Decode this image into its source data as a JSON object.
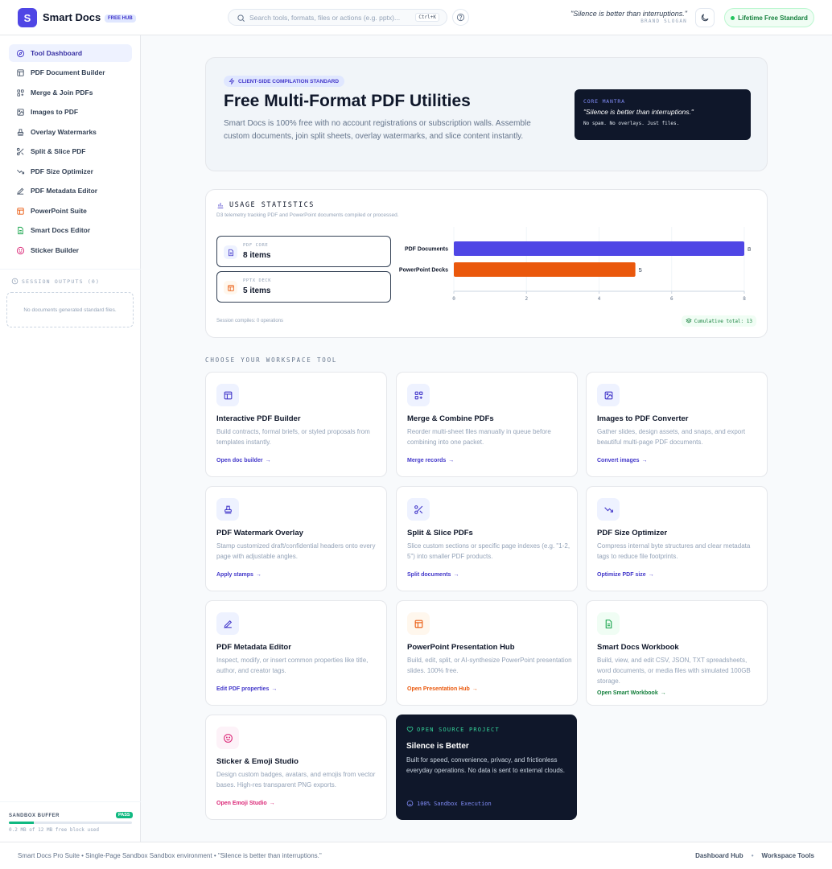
{
  "header": {
    "logo_letter": "S",
    "brand": "Smart Docs",
    "brand_badge": "FREE HUB",
    "search_placeholder": "Search tools, formats, files or actions (e.g. pptx)...",
    "search_shortcut": "Ctrl+K",
    "slogan": "\"Silence is better than interruptions.\"",
    "slogan_label": "BRAND SLOGAN",
    "lifetime_label": "Lifetime Free Standard"
  },
  "sidebar": {
    "items": [
      {
        "label": "Tool Dashboard"
      },
      {
        "label": "PDF Document Builder"
      },
      {
        "label": "Merge & Join PDFs"
      },
      {
        "label": "Images to PDF"
      },
      {
        "label": "Overlay Watermarks"
      },
      {
        "label": "Split & Slice PDF"
      },
      {
        "label": "PDF Size Optimizer"
      },
      {
        "label": "PDF Metadata Editor"
      },
      {
        "label": "PowerPoint Suite"
      },
      {
        "label": "Smart Docs Editor"
      },
      {
        "label": "Sticker Builder"
      }
    ],
    "outputs_title": "SESSION OUTPUTS (0)",
    "outputs_empty": "No documents generated standard files.",
    "buffer_title": "SANDBOX BUFFER",
    "buffer_status": "PASS",
    "buffer_fraction": 0.2,
    "buffer_note": "0.2 MB of 12 MB free block used"
  },
  "hero": {
    "pill": "CLIENT-SIDE COMPILATION STANDARD",
    "title": "Free Multi-Format PDF Utilities",
    "subtitle": "Smart Docs is 100% free with no account registrations or subscription walls. Assemble custom documents, join split sheets, overlay watermarks, and slice content instantly.",
    "mantra_label": "CORE MANTRA",
    "mantra_quote": "\"Silence is better than interruptions.\"",
    "mantra_note": "No spam. No overlays. Just files."
  },
  "stats": {
    "title": "USAGE STATISTICS",
    "subtitle": "D3 telemetry tracking PDF and PowerPoint documents compiled or processed.",
    "cards": [
      {
        "label": "PDF CORE",
        "value": "8 items"
      },
      {
        "label": "PPTX DECK",
        "value": "5 items"
      }
    ],
    "footer_left": "Session compiles: 0 operations",
    "footer_right": "Cumulative total: 13"
  },
  "chart_data": {
    "type": "bar",
    "orientation": "horizontal",
    "categories": [
      "PDF Documents",
      "PowerPoint Decks"
    ],
    "values": [
      8,
      5
    ],
    "value_labels": [
      "8",
      "5"
    ],
    "xlim": [
      0,
      8
    ],
    "xticks": [
      "0",
      "2",
      "4",
      "6",
      "8"
    ],
    "colors": [
      "#4f46e5",
      "#ea580c"
    ],
    "grid": true
  },
  "section_title": "CHOOSE YOUR WORKSPACE TOOL",
  "tools": [
    {
      "title": "Interactive PDF Builder",
      "desc": "Build contracts, formal briefs, or styled proposals from templates instantly.",
      "link": "Open doc builder",
      "color": "#4338ca"
    },
    {
      "title": "Merge & Combine PDFs",
      "desc": "Reorder multi-sheet files manually in queue before combining into one packet.",
      "link": "Merge records",
      "color": "#4338ca"
    },
    {
      "title": "Images to PDF Converter",
      "desc": "Gather slides, design assets, and snaps, and export beautiful multi-page PDF documents.",
      "link": "Convert images",
      "color": "#4338ca"
    },
    {
      "title": "PDF Watermark Overlay",
      "desc": "Stamp customized draft/confidential headers onto every page with adjustable angles.",
      "link": "Apply stamps",
      "color": "#4338ca"
    },
    {
      "title": "Split & Slice PDFs",
      "desc": "Slice custom sections or specific page indexes (e.g. \"1-2, 5\") into smaller PDF products.",
      "link": "Split documents",
      "color": "#4338ca"
    },
    {
      "title": "PDF Size Optimizer",
      "desc": "Compress internal byte structures and clear metadata tags to reduce file footprints.",
      "link": "Optimize PDF size",
      "color": "#4338ca"
    },
    {
      "title": "PDF Metadata Editor",
      "desc": "Inspect, modify, or insert common properties like title, author, and creator tags.",
      "link": "Edit PDF properties",
      "color": "#4338ca"
    },
    {
      "title": "PowerPoint Presentation Hub",
      "desc": "Build, edit, split, or AI-synthesize PowerPoint presentation slides. 100% free.",
      "link": "Open Presentation Hub",
      "color": "#ea580c"
    },
    {
      "title": "Smart Docs Workbook",
      "desc": "Build, view, and edit CSV, JSON, TXT spreadsheets, word documents, or media files with simulated 100GB storage.",
      "link": "Open Smart Workbook",
      "color": "#15803d"
    },
    {
      "title": "Sticker & Emoji Studio",
      "desc": "Design custom badges, avatars, and emojis from vector bases. High-res transparent PNG exports.",
      "link": "Open Emoji Studio",
      "color": "#db2777"
    }
  ],
  "promo": {
    "label": "OPEN SOURCE PROJECT",
    "title": "Silence is Better",
    "desc": "Built for speed, convenience, privacy, and frictionless everyday operations. No data is sent to external clouds.",
    "footer": "100% Sandbox Execution"
  },
  "footer": {
    "left": "Smart Docs Pro Suite • Single-Page Sandbox Sandbox environment • \"Silence is better than interruptions.\"",
    "links": [
      "Dashboard Hub",
      "Workspace Tools"
    ],
    "separator": "•"
  }
}
